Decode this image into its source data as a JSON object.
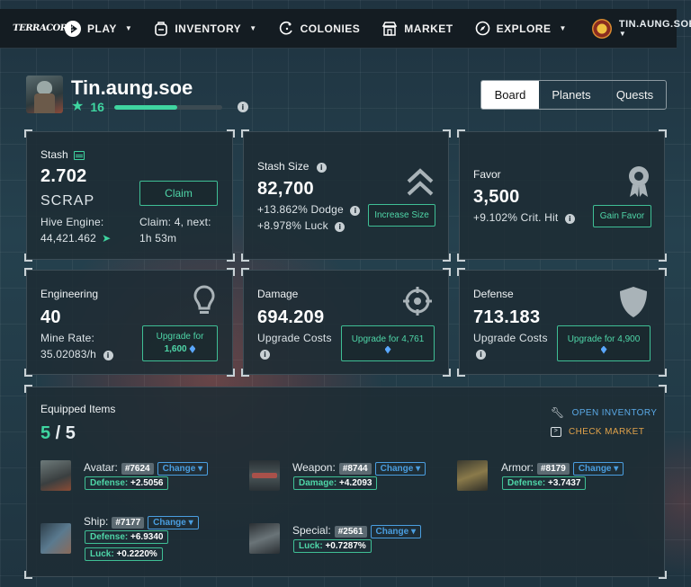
{
  "nav": {
    "logo": "TERRACORE",
    "items": [
      {
        "label": "PLAY",
        "icon": "play-icon",
        "has_caret": true
      },
      {
        "label": "INVENTORY",
        "icon": "backpack-icon",
        "has_caret": true
      },
      {
        "label": "COLONIES",
        "icon": "colonies-icon",
        "has_caret": false
      },
      {
        "label": "MARKET",
        "icon": "store-icon",
        "has_caret": false
      },
      {
        "label": "EXPLORE",
        "icon": "compass-icon",
        "has_caret": true
      }
    ],
    "user": "TIN.AUNG.SOE"
  },
  "profile": {
    "name": "Tin.aung.soe",
    "level": "16",
    "xp_fraction": 0.58
  },
  "tabs": [
    "Board",
    "Planets",
    "Quests"
  ],
  "stash": {
    "label": "Stash",
    "amount": "2.702",
    "unit": "SCRAP",
    "claim_label": "Claim",
    "hive_label": "Hive Engine:",
    "hive_value": "44,421.462",
    "claim_text": "Claim: 4, next:",
    "next_time": "1h 53m"
  },
  "stash_size": {
    "label": "Stash Size",
    "value": "82,700",
    "dodge": "+13.862% Dodge",
    "luck": "+8.978% Luck",
    "button": "Increase Size"
  },
  "favor": {
    "label": "Favor",
    "value": "3,500",
    "crit": "+9.102% Crit. Hit",
    "button": "Gain Favor"
  },
  "engineering": {
    "label": "Engineering",
    "value": "40",
    "rate_label": "Mine Rate:",
    "rate_value": "35.02083/h",
    "button_top": "Upgrade for",
    "button_cost": "1,600"
  },
  "damage": {
    "label": "Damage",
    "value": "694.209",
    "costs_label": "Upgrade Costs",
    "button_top": "Upgrade for 4,761"
  },
  "defense": {
    "label": "Defense",
    "value": "713.183",
    "costs_label": "Upgrade Costs",
    "button_top": "Upgrade for 4,900"
  },
  "equipped": {
    "title": "Equipped Items",
    "count_current": "5",
    "count_sep": " / ",
    "count_total": "5",
    "open_inventory": "OPEN INVENTORY",
    "check_market": "CHECK MARKET",
    "change_label": "Change",
    "items": [
      {
        "name": "Avatar:",
        "id": "#7624",
        "stats": [
          {
            "k": "Defense:",
            "v": "+2.5056"
          }
        ]
      },
      {
        "name": "Weapon:",
        "id": "#8744",
        "stats": [
          {
            "k": "Damage:",
            "v": "+4.2093"
          }
        ]
      },
      {
        "name": "Armor:",
        "id": "#8179",
        "stats": [
          {
            "k": "Defense:",
            "v": "+3.7437"
          }
        ]
      },
      {
        "name": "Ship:",
        "id": "#7177",
        "stats": [
          {
            "k": "Defense:",
            "v": "+6.9340"
          },
          {
            "k": "Luck:",
            "v": "+0.2220%"
          }
        ]
      },
      {
        "name": "Special:",
        "id": "#2561",
        "stats": [
          {
            "k": "Luck:",
            "v": "+0.7287%"
          }
        ]
      }
    ]
  }
}
